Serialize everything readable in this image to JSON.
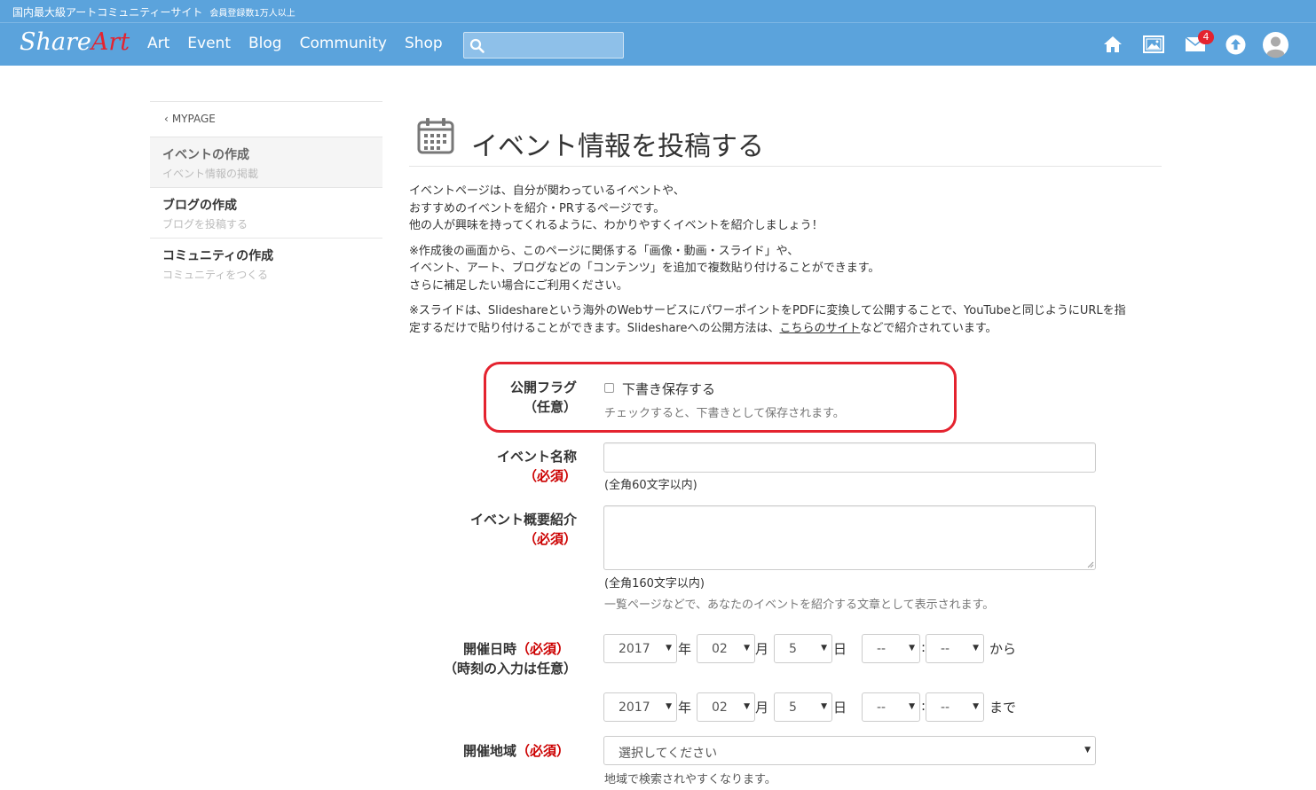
{
  "topstrip": {
    "title": "国内最大級アートコミュニティーサイト",
    "sub": "会員登録数1万人以上"
  },
  "nav": {
    "logo_1": "Share",
    "logo_2": "Art",
    "links": [
      "Art",
      "Event",
      "Blog",
      "Community",
      "Shop"
    ],
    "search_placeholder": "",
    "mail_badge": "4"
  },
  "sidebar": {
    "back": "MYPAGE",
    "items": [
      {
        "title": "イベントの作成",
        "sub": "イベント情報の掲載"
      },
      {
        "title": "ブログの作成",
        "sub": "ブログを投稿する"
      },
      {
        "title": "コミュニティの作成",
        "sub": "コミュニティをつくる"
      }
    ]
  },
  "main": {
    "title": "イベント情報を投稿する",
    "intro": {
      "p1_l1": "イベントページは、自分が関わっているイベントや、",
      "p1_l2": "おすすめのイベントを紹介・PRするページです。",
      "p1_l3": "他の人が興味を持ってくれるように、わかりやすくイベントを紹介しましょう！",
      "p2_l1": "※作成後の画面から、このページに関係する「画像・動画・スライド」や、",
      "p2_l2": "イベント、アート、ブログなどの「コンテンツ」を追加で複数貼り付けることができます。",
      "p2_l3": "さらに補足したい場合にご利用ください。",
      "p3_l1": "※スライドは、Slideshareという海外のWebサービスにパワーポイントをPDFに変換して公開することで、YouTubeと同じようにURLを指",
      "p3_l2a": "定するだけで貼り付けることができます。Slideshareへの公開方法は、",
      "p3_link": "こちらのサイト",
      "p3_l2b": "などで紹介されています。"
    }
  },
  "form": {
    "publish": {
      "label_1": "公開フラグ",
      "label_2": "（任意）",
      "checkbox_label": "下書き保存する",
      "help": "チェックすると、下書きとして保存されます。"
    },
    "event_name": {
      "label": "イベント名称",
      "req": "（必須）",
      "value": "",
      "note": "(全角60文字以内)"
    },
    "event_summary": {
      "label": "イベント概要紹介",
      "req": "（必須）",
      "value": "",
      "note": "(全角160文字以内)",
      "help": "一覧ページなどで、あなたのイベントを紹介する文章として表示されます。"
    },
    "date": {
      "label_1": "開催日時",
      "req": "（必須）",
      "label_2": "（時刻の入力は任意）",
      "start": {
        "year": "2017",
        "month": "02",
        "day": "5",
        "hour": "--",
        "minute": "--"
      },
      "end": {
        "year": "2017",
        "month": "02",
        "day": "5",
        "hour": "--",
        "minute": "--"
      },
      "year_unit": "年",
      "month_unit": "月",
      "day_unit": "日",
      "colon": ":",
      "from": "から",
      "to": "まで"
    },
    "region": {
      "label": "開催地域",
      "req": "（必須）",
      "value": "選択してください",
      "help": "地域で検索されやすくなります。"
    }
  },
  "colors": {
    "brand": "#5ba3dc",
    "accent_red": "#e4232f",
    "required": "#cc0000"
  }
}
